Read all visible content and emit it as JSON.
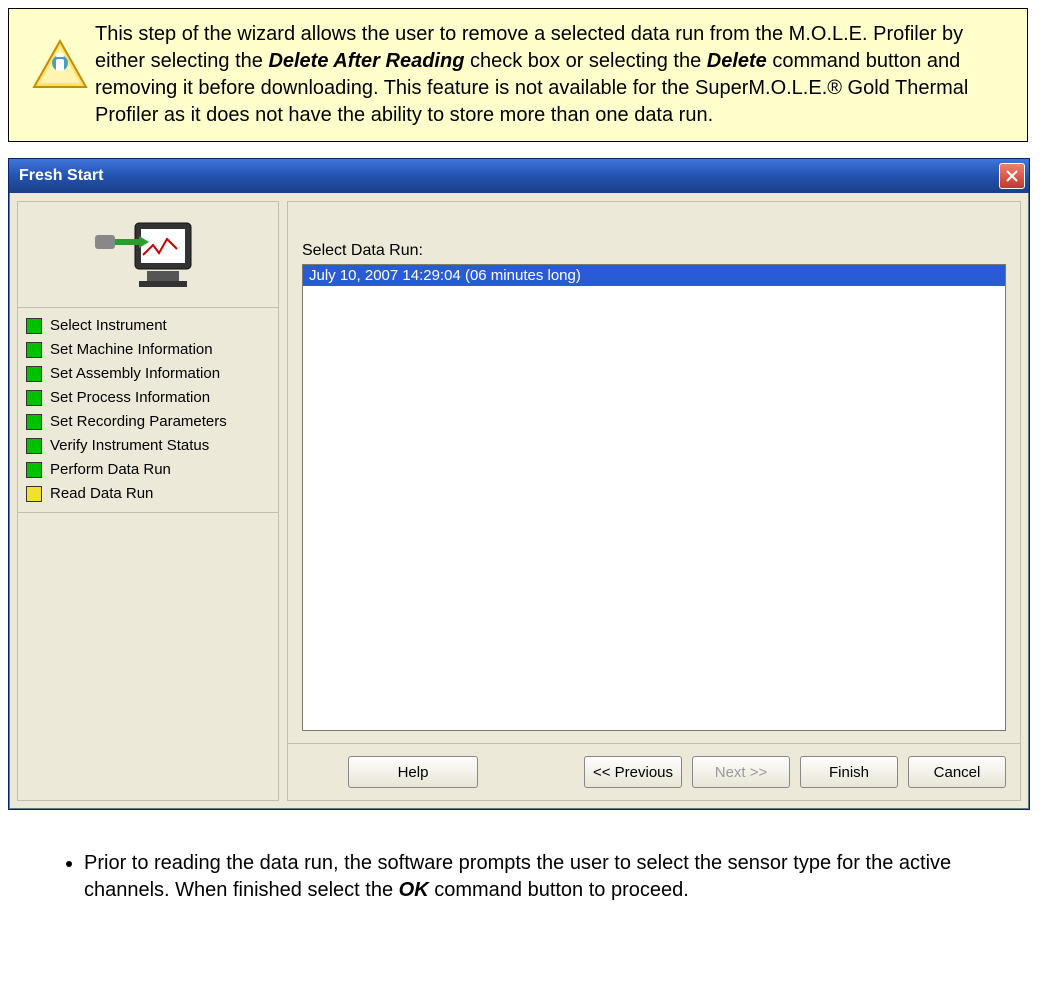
{
  "callout": {
    "text_before_em1": "This step of the wizard allows the user to remove a selected data run from the M.O.L.E. Profiler by either selecting the ",
    "em1": "Delete After Reading",
    "text_between": " check box or selecting the ",
    "em2": "Delete",
    "text_after": " command button and removing it before downloading. This feature is not available for the SuperM.O.L.E.® Gold Thermal Profiler as it does not have the ability to store more than one data run."
  },
  "dialog": {
    "title": "Fresh Start",
    "steps": [
      {
        "label": "Select Instrument",
        "color": "green"
      },
      {
        "label": "Set Machine Information",
        "color": "green"
      },
      {
        "label": "Set Assembly Information",
        "color": "green"
      },
      {
        "label": "Set Process Information",
        "color": "green"
      },
      {
        "label": "Set Recording Parameters",
        "color": "green"
      },
      {
        "label": "Verify Instrument Status",
        "color": "green"
      },
      {
        "label": "Perform Data Run",
        "color": "green"
      },
      {
        "label": "Read Data Run",
        "color": "yellow"
      }
    ],
    "select_label": "Select Data Run:",
    "selected_run": "July 10, 2007    14:29:04    (06 minutes long)",
    "buttons": {
      "help": "Help",
      "previous": "<< Previous",
      "next": "Next >>",
      "finish": "Finish",
      "cancel": "Cancel"
    }
  },
  "post": {
    "bullet_before": "Prior to reading the data run, the software prompts the user to select the sensor type for the active channels. When finished select the ",
    "bullet_em": "OK",
    "bullet_after": " command button to proceed."
  }
}
